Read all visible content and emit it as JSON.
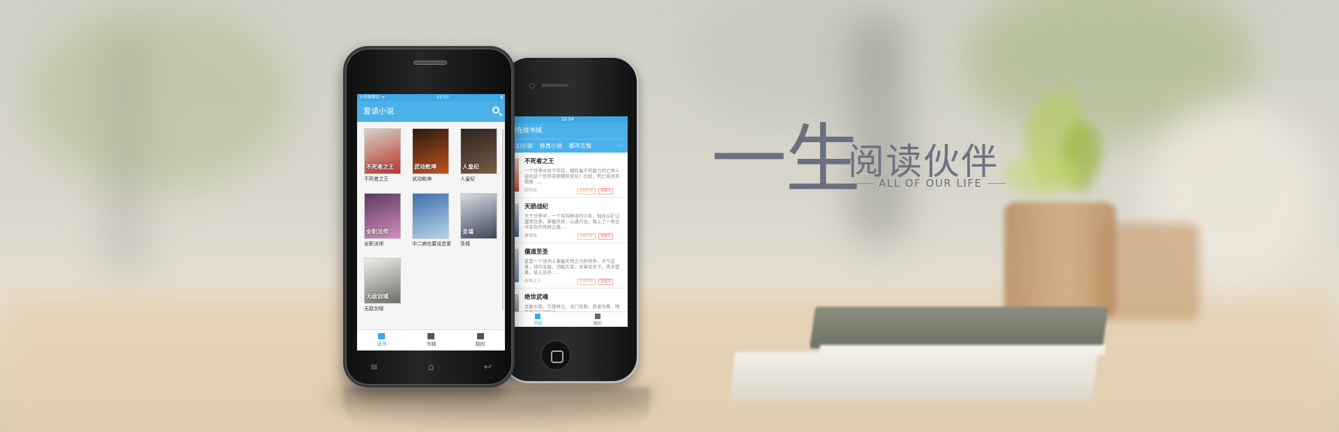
{
  "tagline": {
    "big": "一生",
    "small": "阅读伙伴",
    "english": "ALL OF OUR LIFE"
  },
  "android_app": {
    "status_left": "3·中国移动 ᯤ",
    "status_time": "22:53",
    "status_right": "▮",
    "title": "爱读小说",
    "books": [
      {
        "name": "不死者之王",
        "cover_text": "不死者之王",
        "color_a": "#d6d2c6",
        "color_b": "#b8342d"
      },
      {
        "name": "武动乾坤",
        "cover_text": "武动乾坤",
        "color_a": "#2a1a12",
        "color_b": "#c2531b"
      },
      {
        "name": "人皇纪",
        "cover_text": "人皇纪",
        "color_a": "#2b2422",
        "color_b": "#7b5b45"
      },
      {
        "name": "全职法师",
        "cover_text": "全职法师",
        "color_a": "#5a3c5e",
        "color_b": "#d58cbf"
      },
      {
        "name": "中二病也要谈恋爱",
        "cover_text": "",
        "color_a": "#3d6fa8",
        "color_b": "#b8d4ec"
      },
      {
        "name": "圣墟",
        "cover_text": "圣墟",
        "color_a": "#d8dde4",
        "color_b": "#3c4657"
      },
      {
        "name": "无敌剑域",
        "cover_text": "无敌剑域",
        "color_a": "#eeeeea",
        "color_b": "#6d6d6a"
      }
    ],
    "nav": [
      {
        "label": "读书",
        "active": true
      },
      {
        "label": "书城",
        "active": false
      },
      {
        "label": "我的",
        "active": false
      }
    ],
    "nav_keys": [
      "≡",
      "⌂",
      "↩"
    ]
  },
  "iphone_app": {
    "status_time": "22:54",
    "header": "爱在线书城",
    "tabs": [
      "玄幻小说",
      "修真小说",
      "都市言情"
    ],
    "more": "···",
    "rows": [
      {
        "title": "不死者之王",
        "desc": "一个世界中并不存在，拥有着不死能力的亡种人会给这个世界带来哪些变化？比如，死亡将没有惧意……",
        "author": "胖狗说",
        "words": "144万字",
        "status": "连载中",
        "cover": "#c9453a"
      },
      {
        "title": "天骄战纪",
        "desc": "大千世界中，一个名叫林寻的少年，独自从矿山里爬出来，掌握灵纹，心通万古，踏上了一条古今未有的传奇之路……",
        "author": "萧瑾瑜",
        "words": "196万字",
        "status": "连载中",
        "cover": "#3f5d8a"
      },
      {
        "title": "儒道至圣",
        "desc": "这是一个读书人掌握天地之力的世界。才气在身，诗可杀敌，词能灭军，文章安天下。秀才提笔，纸上谈兵……",
        "author": "永恒之火",
        "words": "520万字",
        "status": "连载中",
        "cover": "#5e7fa0"
      },
      {
        "title": "绝世武魂",
        "desc": "龙脉大陆，万族林立，派门无数。武者为尊，唯有强者方可屹立……",
        "author": "",
        "words": "",
        "status": "",
        "cover": "#6b4b3a"
      }
    ],
    "nav": [
      {
        "label": "书城",
        "active": true
      },
      {
        "label": "我的",
        "active": false
      }
    ]
  },
  "colors": {
    "accent": "#4cb1e8",
    "tagline": "#6a7080"
  }
}
